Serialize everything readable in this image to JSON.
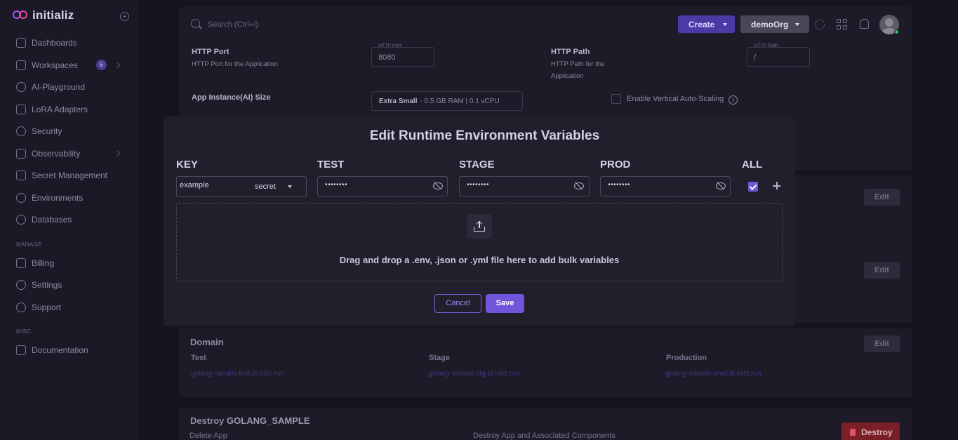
{
  "sidebar": {
    "brand": "initializ",
    "nav": [
      {
        "label": "Dashboards",
        "icon": "home-icon"
      },
      {
        "label": "Workspaces",
        "icon": "folder-icon",
        "badge": "6"
      },
      {
        "label": "AI-Playground",
        "icon": "sparkle-icon"
      },
      {
        "label": "LoRA Adapters",
        "icon": "layers-icon"
      },
      {
        "label": "Security",
        "icon": "shield-icon"
      },
      {
        "label": "Observability",
        "icon": "telescope-icon"
      },
      {
        "label": "Secret Management",
        "icon": "lock-icon"
      },
      {
        "label": "Environments",
        "icon": "network-icon"
      },
      {
        "label": "Databases",
        "icon": "database-icon"
      }
    ],
    "manage_label": "MANAGE",
    "manage": [
      {
        "label": "Billing",
        "icon": "receipt-icon"
      },
      {
        "label": "Settings",
        "icon": "gear-icon"
      },
      {
        "label": "Support",
        "icon": "headset-icon"
      }
    ],
    "misc_label": "MISC",
    "misc": [
      {
        "label": "Documentation",
        "icon": "document-icon"
      }
    ]
  },
  "header": {
    "search_placeholder": "Search (Ctrl+/)",
    "create_label": "Create",
    "org_label": "demoOrg"
  },
  "background": {
    "http_port_title": "HTTP Port",
    "http_port_desc": "HTTP Port for the Application",
    "http_port_field_label": "HTTP Port",
    "http_port_value": "8080",
    "http_path_title": "HTTP Path",
    "http_path_desc_1": "HTTP Path for the",
    "http_path_desc_2": "Application",
    "http_path_field_label": "HTTP Path",
    "http_path_value": "/",
    "instance_size_title": "App Instance(AI) Size",
    "instance_size_bold": "Extra Small",
    "instance_size_rest": "- 0.5 GB RAM | 0.1 vCPU",
    "autoscaling_label": "Enable Vertical Auto-Scaling",
    "edit_label": "Edit",
    "domain_title": "Domain",
    "domain_envs": [
      {
        "label": "Test",
        "url": "golang-sample.test.pi.initz.run"
      },
      {
        "label": "Stage",
        "url": "golang-sample.stg.pi.initz.run"
      },
      {
        "label": "Production",
        "url": "golang-sample.prod.pi.initz.run"
      }
    ],
    "destroy_prefix": "Destroy",
    "destroy_app_name": "GOLANG_SAMPLE",
    "destroy_sub_left": "Delete App",
    "destroy_sub_right": "Destroy App and Associated Components",
    "destroy_button": "Destroy"
  },
  "modal": {
    "title": "Edit Runtime Environment Variables",
    "columns": {
      "key": "KEY",
      "test": "TEST",
      "stage": "STAGE",
      "prod": "PROD",
      "all": "ALL"
    },
    "row": {
      "key": "example",
      "type": "secret",
      "test_masked": "••••••••",
      "stage_masked": "••••••••",
      "prod_masked": "••••••••",
      "all_checked": true
    },
    "dropzone_text": "Drag and drop a .env, .json or .yml file here to add bulk variables",
    "cancel_label": "Cancel",
    "save_label": "Save"
  },
  "colors": {
    "accent": "#6e55d9",
    "background": "#1a1824",
    "modal": "#221f2d",
    "destroy": "#7a1f28"
  }
}
